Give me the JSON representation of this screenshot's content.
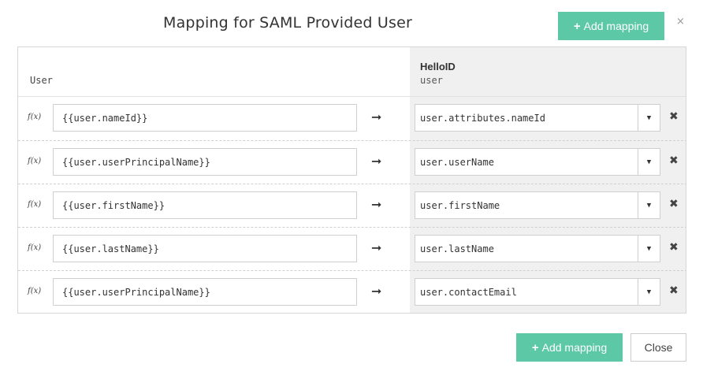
{
  "dialog": {
    "title": "Mapping for SAML Provided User",
    "add_mapping_label": "Add mapping",
    "add_mapping_icon": "+",
    "close_x": "×",
    "close_label": "Close",
    "accent_color": "#5cc8a5"
  },
  "table": {
    "left_header": "User",
    "right_header_title": "HelloID",
    "right_header_sub": "user",
    "function_label": "f(x)",
    "arrow": "➞",
    "caret": "▼",
    "remove": "✖",
    "rows": [
      {
        "source": "{{user.nameId}}",
        "target": "user.attributes.nameId"
      },
      {
        "source": "{{user.userPrincipalName}}",
        "target": "user.userName"
      },
      {
        "source": "{{user.firstName}}",
        "target": "user.firstName"
      },
      {
        "source": "{{user.lastName}}",
        "target": "user.lastName"
      },
      {
        "source": "{{user.userPrincipalName}}",
        "target": "user.contactEmail"
      }
    ]
  }
}
